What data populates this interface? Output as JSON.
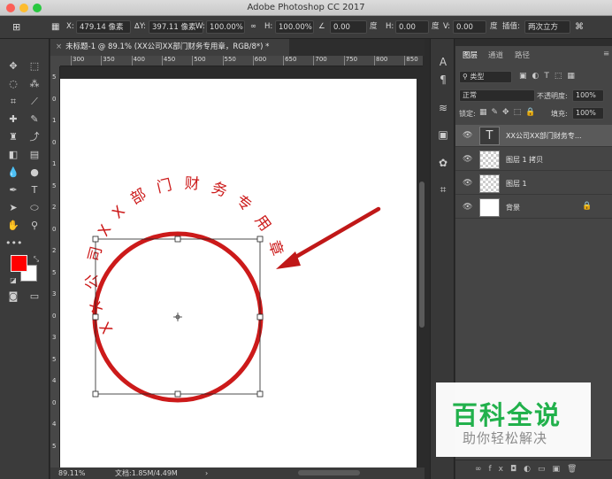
{
  "window": {
    "title": "Adobe Photoshop CC 2017"
  },
  "options": {
    "x_label": "X:",
    "x_value": "479.14 像素",
    "y_label": "Y:",
    "y_value": "397.11 像素",
    "w_label": "W:",
    "w_value": "100.00%",
    "h_label": "H:",
    "h_value": "100.00%",
    "angle_value": "0.00",
    "angle_unit": "度",
    "hskew_label": "H:",
    "hskew_value": "0.00",
    "hskew_unit": "度",
    "vskew_label": "V:",
    "vskew_value": "0.00",
    "vskew_unit": "度",
    "interp_label": "插值:",
    "interp_value": "两次立方"
  },
  "document": {
    "tab_label": "未标题-1 @ 89.1% (XX公司XX部门财务专用章，RGB/8*) *",
    "ruler_h_ticks": [
      "300",
      "350",
      "400",
      "450",
      "500",
      "550",
      "600",
      "650",
      "700",
      "750",
      "800",
      "850"
    ],
    "ruler_v_ticks": [
      "5",
      "0",
      "1",
      "0",
      "1",
      "5",
      "2",
      "0",
      "2",
      "5",
      "3",
      "0",
      "3",
      "5",
      "4",
      "0",
      "4",
      "5"
    ],
    "seal_text": "XX公司XX部门财务专用章"
  },
  "status": {
    "zoom": "89.11%",
    "doc_info": "文档:1.85M/4.49M"
  },
  "panels": {
    "tab_layers": "图层",
    "tab_channels": "通道",
    "tab_paths": "路径",
    "filter_kind": "类型",
    "blend_mode": "正常",
    "opacity_label": "不透明度:",
    "opacity_value": "100%",
    "lock_label": "锁定:",
    "fill_label": "填充:",
    "fill_value": "100%",
    "layers": [
      {
        "name": "XX公司XX部门财务专...",
        "type": "text"
      },
      {
        "name": "图层 1 拷贝",
        "type": "raster"
      },
      {
        "name": "图层 1",
        "type": "raster"
      },
      {
        "name": "背景",
        "type": "background"
      }
    ]
  },
  "watermark": {
    "title": "百科全说",
    "subtitle": "助你轻松解决"
  },
  "colors": {
    "accent_red": "#cc1a1a",
    "foreground": "#ff0000",
    "background": "#ffffff",
    "watermark_green": "#22b14c"
  }
}
